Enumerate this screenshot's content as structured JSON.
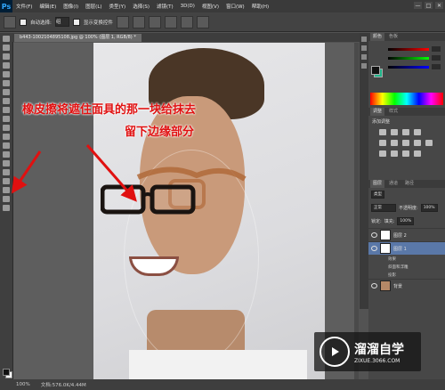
{
  "app": {
    "logo": "Ps"
  },
  "menubar": {
    "items": [
      "文件(F)",
      "编辑(E)",
      "图像(I)",
      "图层(L)",
      "类型(Y)",
      "选择(S)",
      "滤镜(T)",
      "3D(D)",
      "视图(V)",
      "窗口(W)",
      "帮助(H)"
    ]
  },
  "window_controls": [
    "—",
    "□",
    "✕"
  ],
  "options_bar": {
    "auto_select_label": "自动选择:",
    "auto_select_value": "组",
    "show_transform_label": "显示变换控件"
  },
  "document_tab": {
    "label": "b443-1002104895108.jpg @ 100% (图层 1, RGB/8) *"
  },
  "annotations": {
    "line1": "橡皮擦将遮住面具的那一块给抹去",
    "line2": "留下边缘部分"
  },
  "status_bar": {
    "zoom": "100%",
    "doc_info": "文档:576.0K/4.44M"
  },
  "panels": {
    "color_tabs": [
      "颜色",
      "色板"
    ],
    "adjust_tabs": [
      "调整",
      "样式"
    ],
    "adjust_label": "添加调整",
    "layers_tabs": [
      "图层",
      "通道",
      "路径"
    ],
    "kind_label": "类型",
    "blend_mode": "正常",
    "opacity_label": "不透明度:",
    "opacity_value": "100%",
    "lock_label": "锁定:",
    "fill_label": "填充:",
    "fill_value": "100%",
    "layers": [
      {
        "name": "图层 2"
      },
      {
        "name": "图层 1"
      },
      {
        "name": "效果"
      },
      {
        "name": "斜面和浮雕"
      },
      {
        "name": "投影"
      },
      {
        "name": "背景"
      }
    ]
  },
  "watermark": {
    "name": "溜溜自学",
    "url": "ZIXUE.3066.COM"
  },
  "colors": {
    "annotation": "#e01010",
    "selected_layer": "#5a78a8",
    "bg_swatch": "#1fb58a"
  }
}
